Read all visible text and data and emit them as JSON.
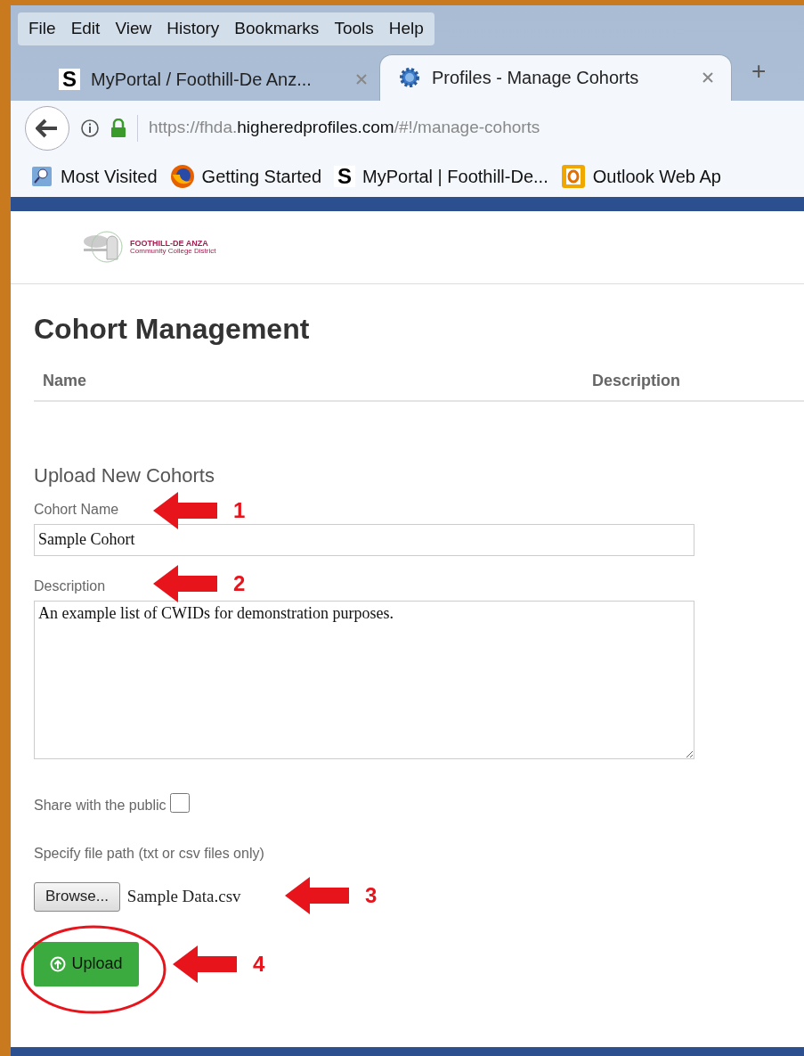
{
  "menu_bar": [
    "File",
    "Edit",
    "View",
    "History",
    "Bookmarks",
    "Tools",
    "Help"
  ],
  "tabs": [
    {
      "title": "MyPortal / Foothill-De Anz...",
      "selected": false,
      "kind": "s",
      "icon_text": "S"
    },
    {
      "title": "Profiles - Manage Cohorts",
      "selected": true,
      "kind": "gear"
    }
  ],
  "new_tab": "+",
  "address": {
    "prefix": "https://fhda.",
    "domain": "higheredprofiles.com",
    "path": "/#!/manage-cohorts"
  },
  "bookmarks": [
    {
      "label": "Most Visited",
      "kind": "folder"
    },
    {
      "label": "Getting Started",
      "kind": "fox"
    },
    {
      "label": "MyPortal | Foothill-De...",
      "kind": "s",
      "icon_text": "S"
    },
    {
      "label": "Outlook Web Ap",
      "kind": "outlook"
    }
  ],
  "logo": {
    "line_1": "FOOTHILL-DE ANZA",
    "line_2": "Community College District"
  },
  "page_title": "Cohort Management",
  "table": {
    "columns": [
      "Name",
      "Description"
    ]
  },
  "form": {
    "title": "Upload New Cohorts",
    "cohort_name": {
      "label": "Cohort Name",
      "value": "Sample Cohort",
      "annotation": "1"
    },
    "description": {
      "label": "Description",
      "value": "An example list of CWIDs for demonstration purposes.",
      "annotation": "2"
    },
    "share": {
      "label": "Share with the public",
      "checked": false
    },
    "file": {
      "label": "Specify file path (txt or csv files only)",
      "button": "Browse...",
      "filename": "Sample Data.csv",
      "annotation": "3"
    },
    "upload": {
      "label": "Upload",
      "annotation": "4"
    }
  }
}
